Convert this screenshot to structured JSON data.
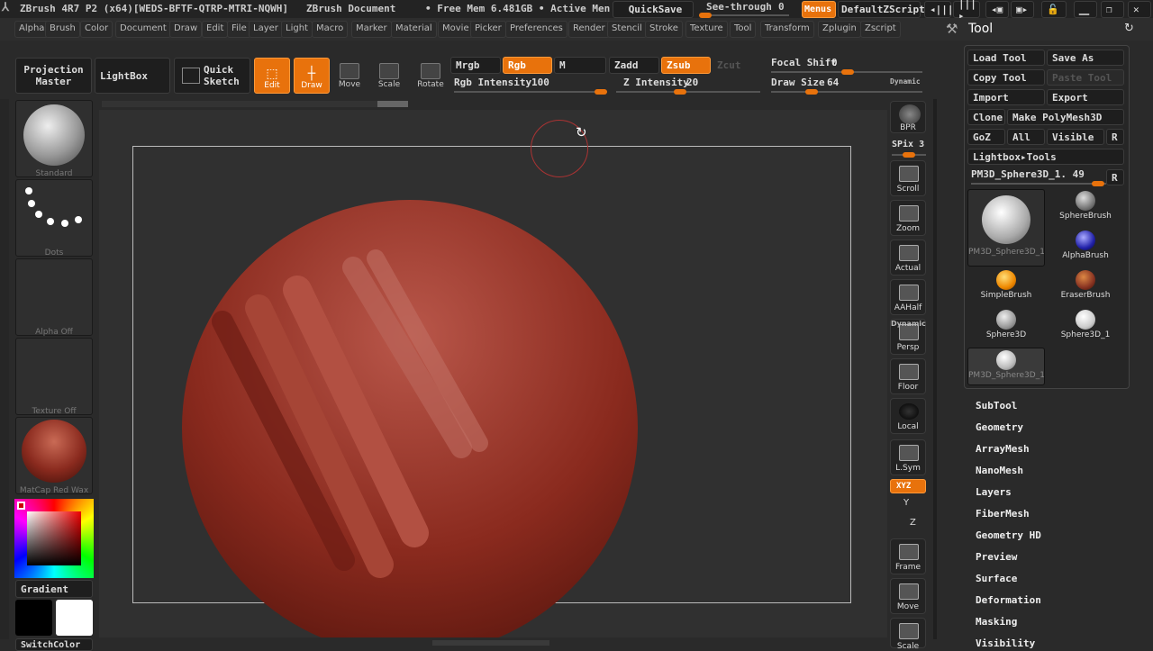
{
  "title_bar": {
    "app": "ZBrush 4R7 P2 (x64)[WEDS-BFTF-QTRP-MTRI-NQWH]",
    "document": "ZBrush Document",
    "mem": "• Free Mem 6.481GB • Active Men",
    "quicksave": "QuickSave",
    "see_through_label": "See-through",
    "see_through_value": "0",
    "menus": "Menus",
    "script": "DefaultZScript"
  },
  "menu": [
    "Alpha",
    "Brush",
    "Color",
    "Document",
    "Draw",
    "Edit",
    "File",
    "Layer",
    "Light",
    "Macro",
    "Marker",
    "Material",
    "Movie",
    "Picker",
    "Preferences",
    "Render",
    "Stencil",
    "Stroke",
    "Texture",
    "Tool",
    "Transform",
    "Zplugin",
    "Zscript"
  ],
  "toolbar": {
    "projection_master": [
      "Projection",
      "Master"
    ],
    "lightbox": "LightBox",
    "quick_sketch": [
      "Quick",
      "Sketch"
    ],
    "edit": "Edit",
    "draw": "Draw",
    "move": "Move",
    "scale": "Scale",
    "rotate": "Rotate",
    "mrgb": "Mrgb",
    "rgb": "Rgb",
    "m": "M",
    "zadd": "Zadd",
    "zsub": "Zsub",
    "zcut": "Zcut",
    "rgb_intensity_label": "Rgb Intensity",
    "rgb_intensity": "100",
    "z_intensity_label": "Z Intensity",
    "z_intensity": "20",
    "focal_shift_label": "Focal Shift",
    "focal_shift": "0",
    "draw_size_label": "Draw Size",
    "draw_size": "64",
    "dynamic": "Dynamic"
  },
  "left_shelf": {
    "brush": "Standard",
    "stroke": "Dots",
    "alpha": "Alpha Off",
    "texture": "Texture Off",
    "material": "MatCap Red Wax",
    "gradient": "Gradient",
    "switch_color": "SwitchColor"
  },
  "right_shelf": {
    "bpr": "BPR",
    "spix_label": "SPix",
    "spix": "3",
    "items": [
      "Scroll",
      "Zoom",
      "Actual",
      "AAHalf",
      "Persp",
      "Floor",
      "Local",
      "L.Sym",
      "Frame",
      "Move",
      "Scale"
    ],
    "persp_top": "Dynamic",
    "xyz": "XYZ",
    "y": "Y",
    "z": "Z"
  },
  "tool_panel": {
    "title": "Tool",
    "load_tool": "Load Tool",
    "save_as": "Save As",
    "copy_tool": "Copy Tool",
    "paste_tool": "Paste Tool",
    "import": "Import",
    "export": "Export",
    "clone": "Clone",
    "make_polymesh": "Make PolyMesh3D",
    "goz": "GoZ",
    "all": "All",
    "visible": "Visible",
    "r": "R",
    "lightbox_tools": "Lightbox▸Tools",
    "current_tool": "PM3D_Sphere3D_1. 49",
    "thumbs": [
      "PM3D_Sphere3D_1",
      "SphereBrush",
      "AlphaBrush",
      "SimpleBrush",
      "EraserBrush",
      "Sphere3D",
      "Sphere3D_1",
      "PM3D_Sphere3D_1"
    ],
    "subpalettes": [
      "SubTool",
      "Geometry",
      "ArrayMesh",
      "NanoMesh",
      "Layers",
      "FiberMesh",
      "Geometry HD",
      "Preview",
      "Surface",
      "Deformation",
      "Masking",
      "Visibility"
    ]
  },
  "colors": {
    "accent": "#e8720c",
    "clay": "#8a2a1e"
  }
}
